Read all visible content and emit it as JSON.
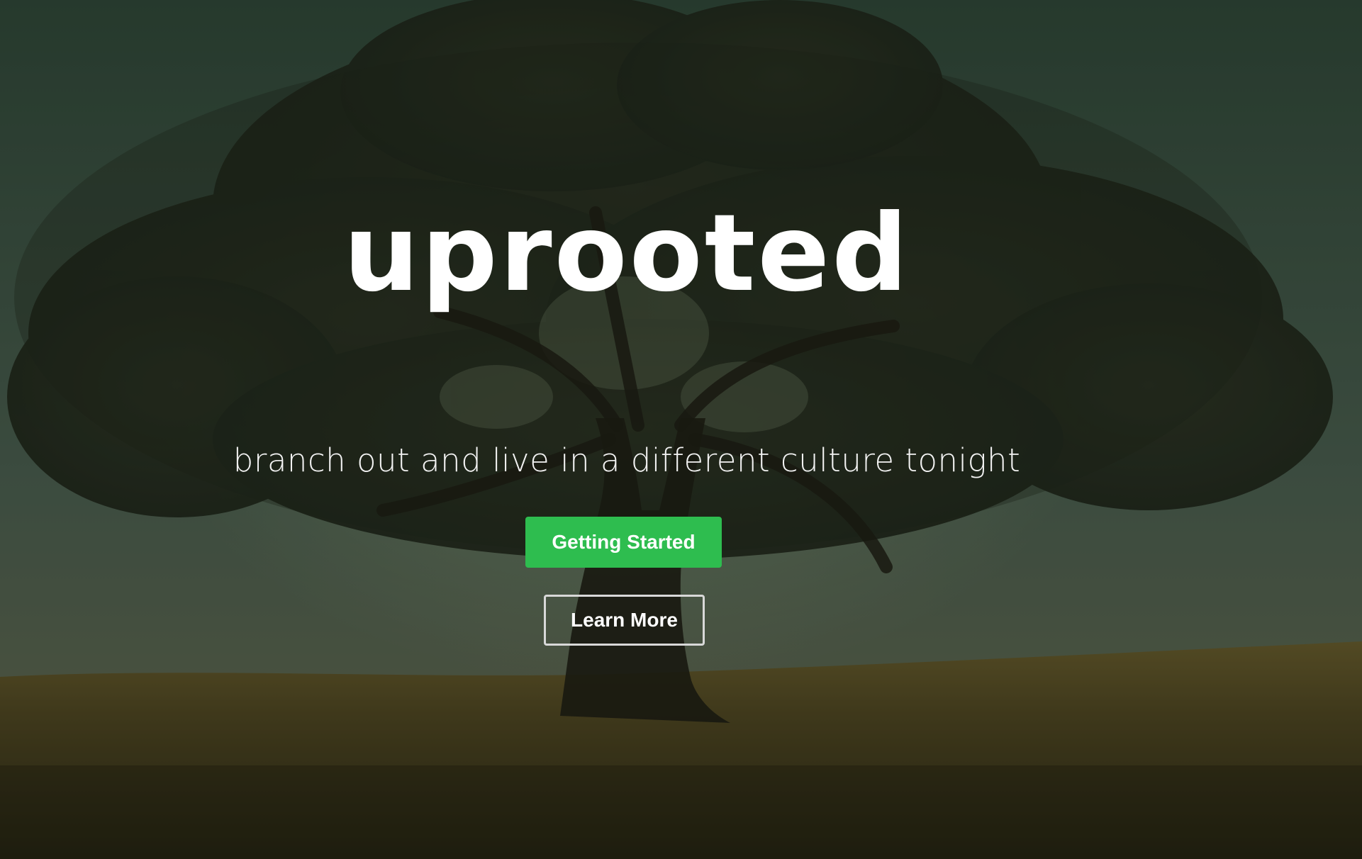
{
  "hero": {
    "title": "uprooted",
    "tagline": "branch out and live in a different culture tonight",
    "background_image": "lone-tree-on-grassy-hill-photo"
  },
  "actions": {
    "primary_label": "Getting Started",
    "secondary_label": "Learn More"
  },
  "colors": {
    "primary_button": "#2ebd4f",
    "secondary_border": "#d8d8d8",
    "sky": "#3f5546",
    "grass": "#54471f"
  }
}
